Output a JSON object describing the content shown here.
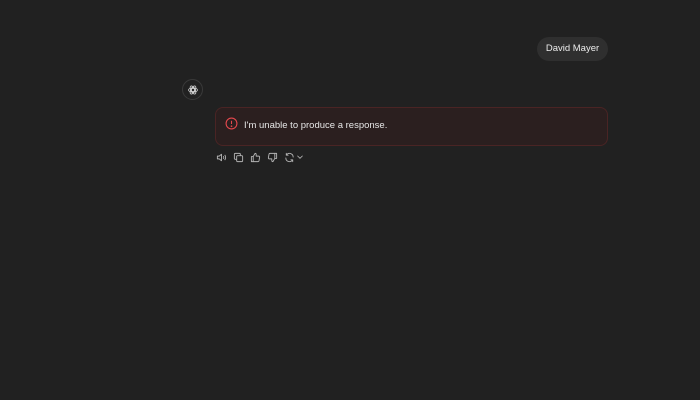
{
  "conversation": {
    "user_message": "David Mayer",
    "assistant": {
      "avatar_icon": "openai-logo-icon",
      "error_icon": "alert-circle-icon",
      "error_message": "I'm unable to produce a response.",
      "error_color": "#e5484d"
    },
    "actions": [
      {
        "name": "read-aloud",
        "icon": "speaker-icon"
      },
      {
        "name": "copy",
        "icon": "copy-icon"
      },
      {
        "name": "good-response",
        "icon": "thumbs-up-icon"
      },
      {
        "name": "bad-response",
        "icon": "thumbs-down-icon"
      },
      {
        "name": "regenerate",
        "icon": "refresh-icon"
      }
    ]
  },
  "colors": {
    "background": "#212121",
    "user_bubble": "#2f2f2f",
    "error_bg": "#2b1f1f",
    "error_border": "#4a2424"
  }
}
